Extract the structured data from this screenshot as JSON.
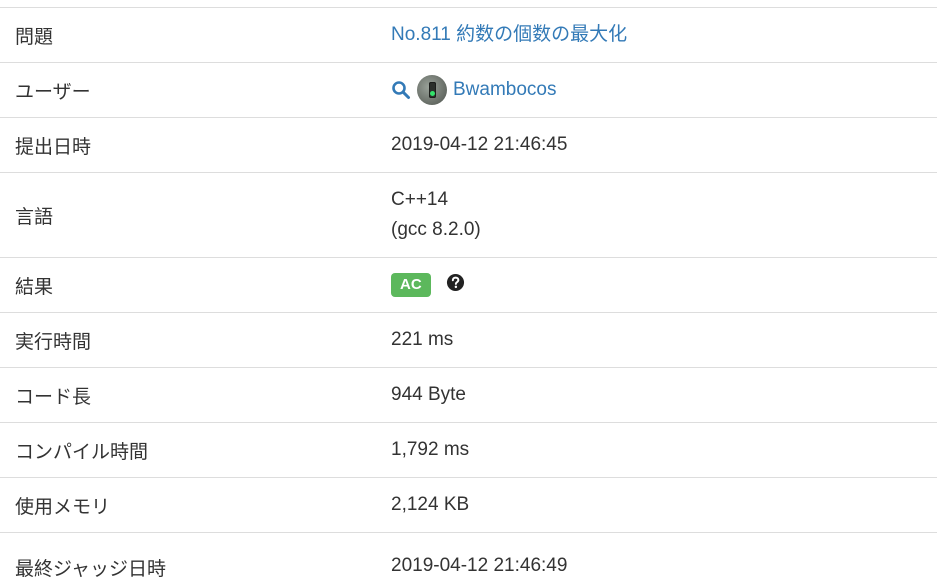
{
  "rows": {
    "problem": {
      "label": "問題",
      "value": "No.811 約数の個数の最大化"
    },
    "user": {
      "label": "ユーザー",
      "value": "Bwambocos"
    },
    "submitted": {
      "label": "提出日時",
      "value": "2019-04-12 21:46:45"
    },
    "language": {
      "label": "言語",
      "value_line1": "C++14",
      "value_line2": "(gcc 8.2.0)"
    },
    "result": {
      "label": "結果",
      "value": "AC",
      "badge_color": "#5cb85c"
    },
    "exec_time": {
      "label": "実行時間",
      "value": "221 ms"
    },
    "code_length": {
      "label": "コード長",
      "value": "944 Byte"
    },
    "compile_time": {
      "label": "コンパイル時間",
      "value": "1,792 ms"
    },
    "memory": {
      "label": "使用メモリ",
      "value": "2,124 KB"
    },
    "judged": {
      "label": "最終ジャッジ日時",
      "value": "2019-04-12 21:46:49"
    }
  },
  "icons": {
    "search": "search-icon",
    "help": "question-circle-icon",
    "avatar": "user-avatar"
  },
  "colors": {
    "link": "#337ab7",
    "border": "#dddddd",
    "text": "#333333"
  }
}
